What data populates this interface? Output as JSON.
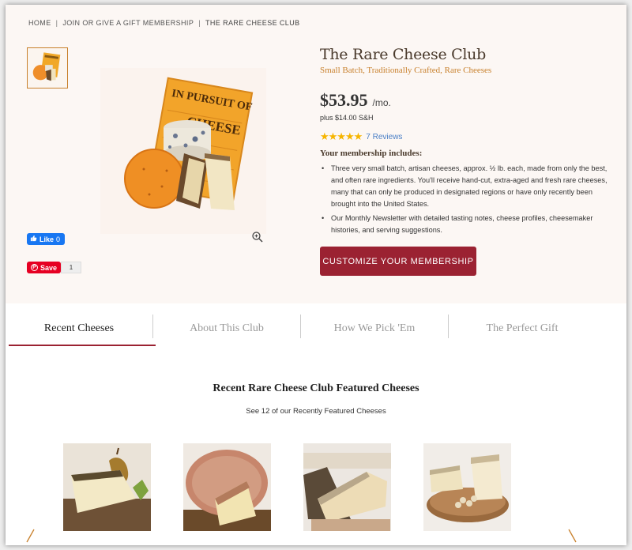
{
  "breadcrumb": {
    "items": [
      "HOME",
      "JOIN OR GIVE A GIFT MEMBERSHIP",
      "THE RARE CHEESE CLUB"
    ]
  },
  "product": {
    "title": "The Rare Cheese Club",
    "subtitle": "Small Batch, Traditionally Crafted, Rare Cheeses",
    "price": "$53.95",
    "price_period": "/mo.",
    "shipping": "plus $14.00 S&H",
    "rating": 5,
    "stars": "★★★★★",
    "reviews_label": "7 Reviews",
    "includes_heading": "Your membership includes:",
    "includes": [
      "Three very small batch, artisan cheeses, approx. ½ lb. each, made from only the best, and often rare ingredients. You'll receive hand-cut, extra-aged and fresh rare cheeses, many that can only be produced in designated regions or have only recently been brought into the United States.",
      "Our Monthly Newsletter with detailed tasting notes, cheese profiles, cheesemaker histories, and serving suggestions."
    ],
    "cta_label": "CUSTOMIZE YOUR MEMBERSHIP",
    "book_text": "IN PURSUIT OF CHEESE"
  },
  "social": {
    "fb_label": "Like",
    "fb_count": "0",
    "pin_label": "Save",
    "pin_count": "1"
  },
  "tabs": [
    {
      "label": "Recent Cheeses",
      "active": true
    },
    {
      "label": "About This Club",
      "active": false
    },
    {
      "label": "How We Pick 'Em",
      "active": false
    },
    {
      "label": "The Perfect Gift",
      "active": false
    }
  ],
  "featured": {
    "title": "Recent Rare Cheese Club Featured Cheeses",
    "subtitle": "See 12 of our Recently Featured Cheeses"
  },
  "colors": {
    "accent": "#9b2232",
    "gold": "#c8802c",
    "hero_bg": "#fcf7f4",
    "star": "#f6b500",
    "link": "#4a7fc6"
  }
}
